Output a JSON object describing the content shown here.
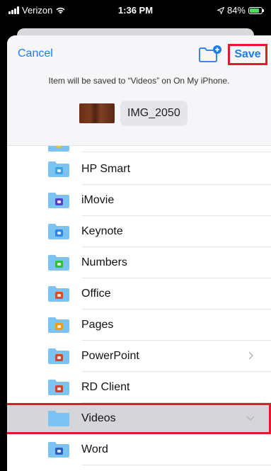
{
  "status_bar": {
    "carrier": "Verizon",
    "time": "1:36 PM",
    "battery": "84%",
    "battery_level": 0.84
  },
  "header": {
    "cancel_label": "Cancel",
    "save_label": "Save",
    "message": "Item will be saved to “Videos” on On My iPhone.",
    "file_name": "IMG_2050"
  },
  "colors": {
    "accent": "#1a7cf0",
    "highlight": "#e21a2c",
    "folder": "#7cc3f2"
  },
  "folders": [
    {
      "label": "HP Smart",
      "badge": "hp-smart-icon",
      "badge_color": "#3aa3e6"
    },
    {
      "label": "iMovie",
      "badge": "imovie-star-icon",
      "badge_color": "#5a3cc9"
    },
    {
      "label": "Keynote",
      "badge": "keynote-icon",
      "badge_color": "#2b82f0"
    },
    {
      "label": "Numbers",
      "badge": "numbers-icon",
      "badge_color": "#2fbf3a"
    },
    {
      "label": "Office",
      "badge": "office-icon",
      "badge_color": "#e24a1c"
    },
    {
      "label": "Pages",
      "badge": "pages-icon",
      "badge_color": "#f29a1a"
    },
    {
      "label": "PowerPoint",
      "badge": "powerpoint-icon",
      "badge_color": "#d24726"
    },
    {
      "label": "RD Client",
      "badge": "rd-client-icon",
      "badge_color": "#c9452c"
    },
    {
      "label": "Videos",
      "badge": "none",
      "badge_color": "#7cc3f2"
    },
    {
      "label": "Word",
      "badge": "word-icon",
      "badge_color": "#2b5fc4"
    }
  ]
}
